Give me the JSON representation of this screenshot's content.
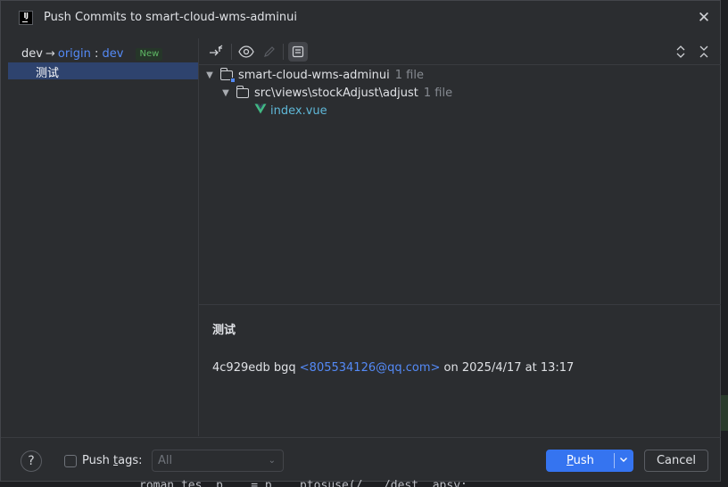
{
  "window": {
    "title": "Push Commits to smart-cloud-wms-adminui",
    "close_glyph": "✕",
    "logo_text": "IJ"
  },
  "left_panel": {
    "local_branch": "dev",
    "arrow": "→",
    "remote_name": "origin",
    "separator": " : ",
    "remote_branch": "dev",
    "new_badge": "New",
    "commits": [
      {
        "message": "测试"
      }
    ]
  },
  "toolbar": {
    "icons": [
      "collapse-branches-icon",
      "show-diff-icon",
      "edit-icon",
      "details-toggle-icon",
      "expand-all-icon",
      "collapse-all-icon"
    ]
  },
  "tree": {
    "module": {
      "name": "smart-cloud-wms-adminui",
      "count": "1 file"
    },
    "folder": {
      "name": "src\\views\\stockAdjust\\adjust",
      "count": "1 file"
    },
    "file": {
      "name": "index.vue"
    }
  },
  "details": {
    "message": "测试",
    "hash": "4c929edb",
    "author": "bgq",
    "email": "<805534126@qq.com>",
    "date_text": "on 2025/4/17 at 13:17"
  },
  "bottom": {
    "help_glyph": "?",
    "push_tags_label_pre": "Push ",
    "push_tags_label_mnemonic": "t",
    "push_tags_label_post": "ags:",
    "push_tags_checked": false,
    "tags_select_value": "All",
    "push_label_mnemonic": "P",
    "push_label_rest": "ush",
    "cancel_label": "Cancel"
  },
  "background_code": "roman tes. p    = p. . ptosuse(/   /dest  apsy;     ,",
  "colors": {
    "accent": "#3574f0",
    "selection": "#2e436e",
    "link": "#548af7",
    "new_badge": "#5fb865",
    "file_modified": "#5fb8d8"
  }
}
